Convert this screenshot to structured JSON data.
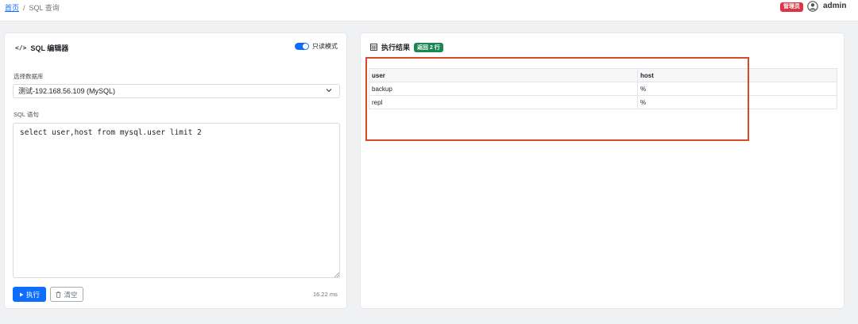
{
  "breadcrumb": {
    "home": "首页",
    "separator": "/",
    "current": "SQL 查询"
  },
  "user": {
    "role_badge": "管理员",
    "name": "admin",
    "avatar_icon": "user-circle-icon"
  },
  "editor": {
    "title": "SQL 编辑器",
    "title_icon": "code-icon",
    "readonly_toggle_label": "只读模式",
    "readonly_toggle_on": true,
    "db_label": "选择数据库",
    "db_selected": "测试-192.168.56.109 (MySQL)",
    "sql_label": "SQL 语句",
    "sql_text": "select user,host from mysql.user limit 2",
    "run_label": "执行",
    "clear_label": "清空",
    "elapsed": "16.22 ms"
  },
  "results": {
    "title": "执行结果",
    "title_icon": "table-icon",
    "count_badge": "返回 2 行",
    "columns": [
      "user",
      "host"
    ],
    "rows": [
      [
        "backup",
        "%"
      ],
      [
        "repl",
        "%"
      ]
    ]
  },
  "colors": {
    "primary": "#0d6efd",
    "danger": "#dc3545",
    "success": "#198754",
    "annotation": "#d9472b"
  }
}
